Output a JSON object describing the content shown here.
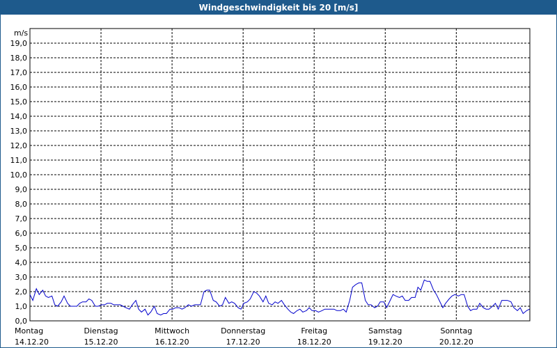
{
  "chart_data": {
    "type": "line",
    "title": "Windgeschwindigkeit bis 20 [m/s]",
    "ylabel": "m/s",
    "ylim": [
      0,
      20
    ],
    "y_ticks": [
      "0,0",
      "1,0",
      "2,0",
      "3,0",
      "4,0",
      "5,0",
      "6,0",
      "7,0",
      "8,0",
      "9,0",
      "10,0",
      "11,0",
      "12,0",
      "13,0",
      "14,0",
      "15,0",
      "16,0",
      "17,0",
      "18,0",
      "19,0"
    ],
    "x_labels": [
      {
        "day": "Montag",
        "date": "14.12.20"
      },
      {
        "day": "Dienstag",
        "date": "15.12.20"
      },
      {
        "day": "Mittwoch",
        "date": "16.12.20"
      },
      {
        "day": "Donnerstag",
        "date": "17.12.20"
      },
      {
        "day": "Freitag",
        "date": "18.12.20"
      },
      {
        "day": "Samstag",
        "date": "19.12.20"
      },
      {
        "day": "Sonntag",
        "date": "20.12.20"
      }
    ],
    "xlim": [
      0,
      7
    ],
    "grid": true,
    "line_color": "#0000cc",
    "series": [
      {
        "x": [
          0,
          0.04,
          0.09,
          0.13,
          0.18,
          0.22,
          0.26,
          0.31,
          0.35,
          0.39,
          0.44,
          0.48,
          0.53,
          0.57,
          0.61,
          0.66,
          0.7,
          0.74,
          0.79,
          0.83,
          0.87,
          0.92,
          0.96,
          1.01,
          1.05,
          1.09,
          1.14,
          1.18,
          1.22,
          1.27,
          1.31,
          1.35,
          1.4,
          1.44,
          1.49,
          1.53,
          1.57,
          1.62,
          1.66,
          1.7,
          1.75,
          1.79,
          1.84,
          1.88,
          1.92,
          1.97,
          2.01,
          2.05,
          2.1,
          2.14,
          2.18,
          2.23,
          2.27,
          2.32,
          2.36,
          2.4,
          2.45,
          2.49,
          2.53,
          2.58,
          2.62,
          2.67,
          2.71,
          2.75,
          2.8,
          2.84,
          2.88,
          2.93,
          2.97,
          3.01,
          3.06,
          3.1,
          3.15,
          3.19,
          3.23,
          3.28,
          3.32,
          3.36,
          3.41,
          3.45,
          3.49,
          3.54,
          3.58,
          3.63,
          3.67,
          3.71,
          3.76,
          3.8,
          3.84,
          3.89,
          3.93,
          3.97,
          4.02,
          4.06,
          4.11,
          4.15,
          4.19,
          4.24,
          4.28,
          4.32,
          4.37,
          4.41,
          4.45,
          4.5,
          4.54,
          4.59,
          4.63,
          4.67,
          4.72,
          4.76,
          4.8,
          4.85,
          4.89,
          4.93,
          4.98,
          5.02,
          5.07,
          5.11,
          5.15,
          5.2,
          5.24,
          5.28,
          5.33,
          5.37,
          5.42,
          5.46,
          5.5,
          5.55,
          5.59,
          5.63,
          5.68,
          5.72,
          5.76,
          5.81,
          5.85,
          5.9,
          5.94,
          5.98,
          6.03,
          6.07,
          6.11,
          6.16,
          6.2,
          6.24,
          6.29,
          6.33,
          6.38,
          6.42,
          6.46,
          6.51,
          6.55,
          6.59,
          6.64,
          6.68,
          6.72,
          6.77,
          6.81,
          6.86,
          6.9,
          6.94,
          6.99,
          7.03
        ],
        "y": [
          1.8,
          1.4,
          2.2,
          1.8,
          2.1,
          1.7,
          1.6,
          1.7,
          1.1,
          1.0,
          1.3,
          1.7,
          1.2,
          1.0,
          1.0,
          1.0,
          1.2,
          1.3,
          1.3,
          1.5,
          1.4,
          1.0,
          1.0,
          1.1,
          1.1,
          1.2,
          1.2,
          1.1,
          1.1,
          1.1,
          1.0,
          0.9,
          0.8,
          1.1,
          1.4,
          0.8,
          0.6,
          0.8,
          0.4,
          0.6,
          1.0,
          0.5,
          0.4,
          0.5,
          0.5,
          0.8,
          0.8,
          0.9,
          0.9,
          0.8,
          0.9,
          1.1,
          1.0,
          1.1,
          1.1,
          1.1,
          2.0,
          2.1,
          2.1,
          1.4,
          1.3,
          1.0,
          1.1,
          1.6,
          1.2,
          1.3,
          1.2,
          0.9,
          0.8,
          1.2,
          1.3,
          1.5,
          2.0,
          1.9,
          1.7,
          1.3,
          1.7,
          1.2,
          1.1,
          1.3,
          1.2,
          1.4,
          1.1,
          0.8,
          0.6,
          0.5,
          0.7,
          0.8,
          0.6,
          0.7,
          0.9,
          0.7,
          0.7,
          0.6,
          0.7,
          0.8,
          0.8,
          0.8,
          0.8,
          0.7,
          0.7,
          0.8,
          0.6,
          1.4,
          2.3,
          2.5,
          2.6,
          2.6,
          1.4,
          1.1,
          1.1,
          0.9,
          1.0,
          1.3,
          1.3,
          0.9,
          1.4,
          1.8,
          1.7,
          1.6,
          1.7,
          1.4,
          1.4,
          1.6,
          1.6,
          2.3,
          2.1,
          2.8,
          2.7,
          2.7,
          2.1,
          1.8,
          1.4,
          0.9,
          1.2,
          1.5,
          1.7,
          1.8,
          1.7,
          1.8,
          1.8,
          1.0,
          0.7,
          0.8,
          0.8,
          1.2,
          0.9,
          0.8,
          0.8,
          1.0,
          1.2,
          0.8,
          1.4,
          1.4,
          1.4,
          1.3,
          0.9,
          0.7,
          0.9,
          0.5,
          0.7,
          0.8
        ]
      }
    ]
  }
}
